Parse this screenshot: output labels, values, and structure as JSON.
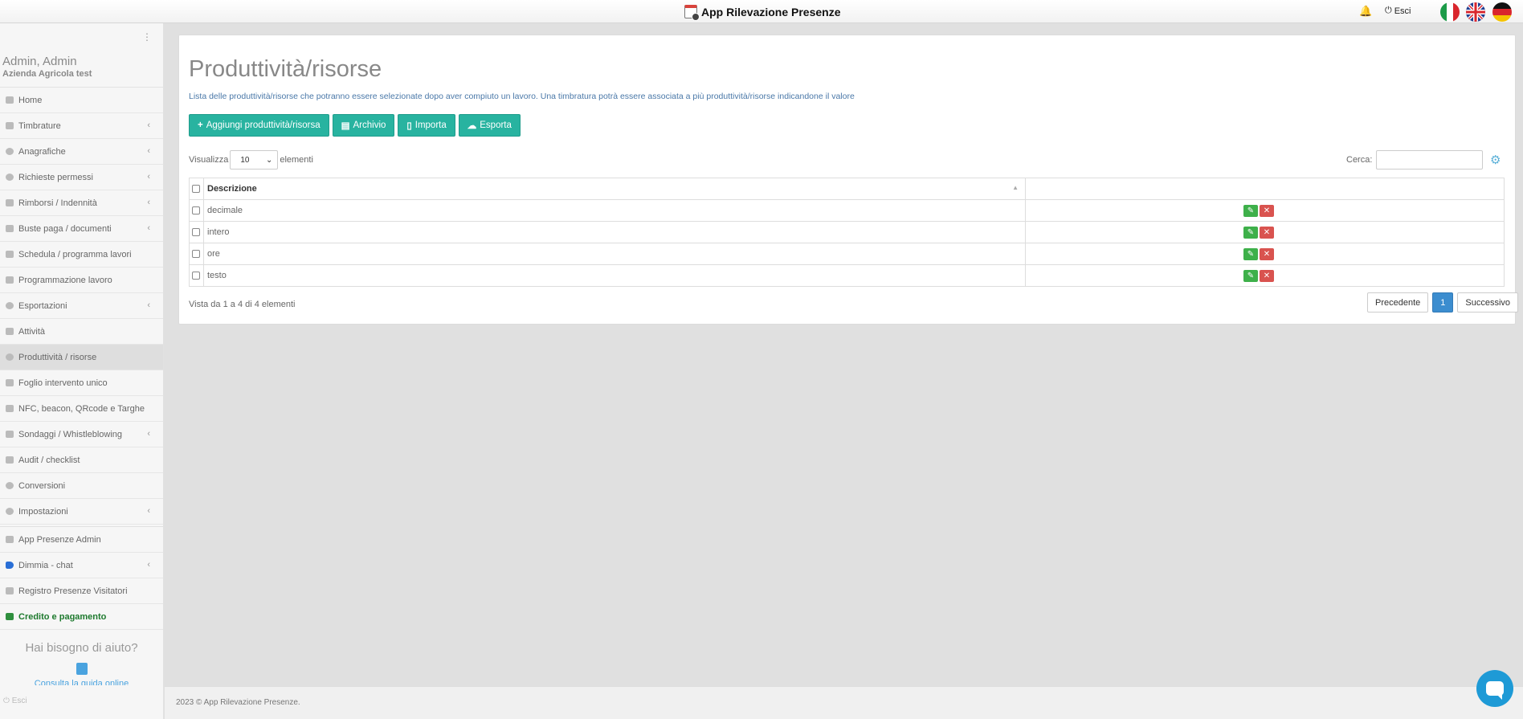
{
  "topbar": {
    "app_title": "App Rilevazione Presenze",
    "logout_label": "Esci",
    "languages": [
      "Italiano",
      "English",
      "Deutsch"
    ]
  },
  "sidebar": {
    "user_name": "Admin, Admin",
    "company": "Azienda Agricola test",
    "items": [
      {
        "label": "Home",
        "icon": "home-icon",
        "submenu": false
      },
      {
        "label": "Timbrature",
        "icon": "list-icon",
        "submenu": true
      },
      {
        "label": "Anagrafiche",
        "icon": "users-icon",
        "submenu": true
      },
      {
        "label": "Richieste permessi",
        "icon": "comment-icon",
        "submenu": true
      },
      {
        "label": "Rimborsi / Indennità",
        "icon": "list-icon",
        "submenu": true
      },
      {
        "label": "Buste paga / documenti",
        "icon": "document-icon",
        "submenu": true
      },
      {
        "label": "Schedula / programma lavori",
        "icon": "briefcase-icon",
        "submenu": false
      },
      {
        "label": "Programmazione lavoro",
        "icon": "calendar-icon",
        "submenu": false
      },
      {
        "label": "Esportazioni",
        "icon": "cloud-download-icon",
        "submenu": true
      },
      {
        "label": "Attività",
        "icon": "tasks-icon",
        "submenu": false
      },
      {
        "label": "Produttività / risorse",
        "icon": "resource-icon",
        "submenu": false,
        "active": true
      },
      {
        "label": "Foglio intervento unico",
        "icon": "sheet-icon",
        "submenu": false
      },
      {
        "label": "NFC, beacon, QRcode e Targhe",
        "icon": "tags-icon",
        "submenu": false
      },
      {
        "label": "Sondaggi / Whistleblowing",
        "icon": "list-icon",
        "submenu": true
      },
      {
        "label": "Audit / checklist",
        "icon": "checklist-icon",
        "submenu": false
      },
      {
        "label": "Conversioni",
        "icon": "convert-icon",
        "submenu": false
      },
      {
        "label": "Impostazioni",
        "icon": "settings-icon",
        "submenu": true
      }
    ],
    "extra_items": [
      {
        "label": "App Presenze Admin",
        "icon": "binoculars-icon",
        "submenu": false
      },
      {
        "label": "Dimmia - chat",
        "icon": "dimmia-icon",
        "submenu": true
      },
      {
        "label": "Registro Presenze Visitatori",
        "icon": "pen-icon",
        "submenu": false
      },
      {
        "label": "Credito e pagamento",
        "icon": "trophy-icon",
        "submenu": false
      }
    ],
    "help_title": "Hai bisogno di aiuto?",
    "help_link": "Consulta la guida online",
    "logout": "Esci"
  },
  "main": {
    "title": "Produttività/risorse",
    "description": "Lista delle produttività/risorse che potranno essere selezionate dopo aver compiuto un lavoro. Una timbratura potrà essere associata a più produttività/risorse indicandone il valore",
    "buttons": {
      "add": "Aggiungi produttività/risorsa",
      "archive": "Archivio",
      "import": "Importa",
      "export": "Esporta"
    },
    "show_label": "Visualizza",
    "show_value": "10",
    "show_suffix": "elementi",
    "search_label": "Cerca:",
    "table": {
      "header_description": "Descrizione",
      "rows": [
        "decimale",
        "intero",
        "ore",
        "testo"
      ]
    },
    "info": "Vista da 1 a 4 di 4 elementi",
    "pagination": {
      "previous": "Precedente",
      "current": "1",
      "next": "Successivo"
    }
  },
  "footer": {
    "text": "2023 © App Rilevazione Presenze."
  },
  "colors": {
    "accent": "#28b3a0",
    "edit": "#3eb04a",
    "delete": "#d9534f",
    "page_active": "#3c8dcf"
  }
}
